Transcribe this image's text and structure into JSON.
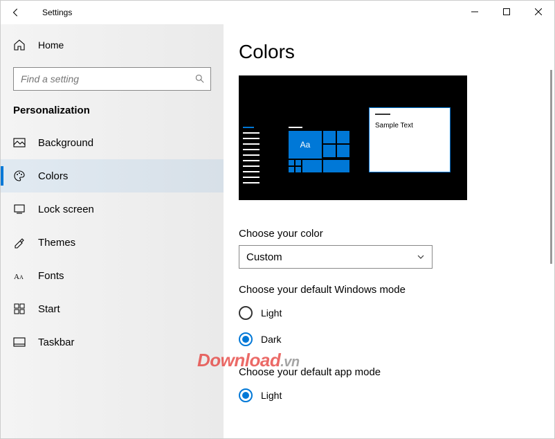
{
  "titlebar": {
    "app_name": "Settings"
  },
  "sidebar": {
    "home_label": "Home",
    "search_placeholder": "Find a setting",
    "section_title": "Personalization",
    "items": [
      {
        "label": "Background"
      },
      {
        "label": "Colors"
      },
      {
        "label": "Lock screen"
      },
      {
        "label": "Themes"
      },
      {
        "label": "Fonts"
      },
      {
        "label": "Start"
      },
      {
        "label": "Taskbar"
      }
    ]
  },
  "main": {
    "page_title": "Colors",
    "preview": {
      "sample_text": "Sample Text",
      "tile_glyph": "Aa"
    },
    "choose_color": {
      "label": "Choose your color",
      "value": "Custom"
    },
    "windows_mode": {
      "label": "Choose your default Windows mode",
      "options": {
        "light": "Light",
        "dark": "Dark"
      },
      "selected": "dark"
    },
    "app_mode": {
      "label": "Choose your default app mode",
      "options": {
        "light": "Light"
      },
      "selected": "light"
    }
  },
  "watermark": {
    "main": "Download",
    "suffix": ".vn"
  }
}
